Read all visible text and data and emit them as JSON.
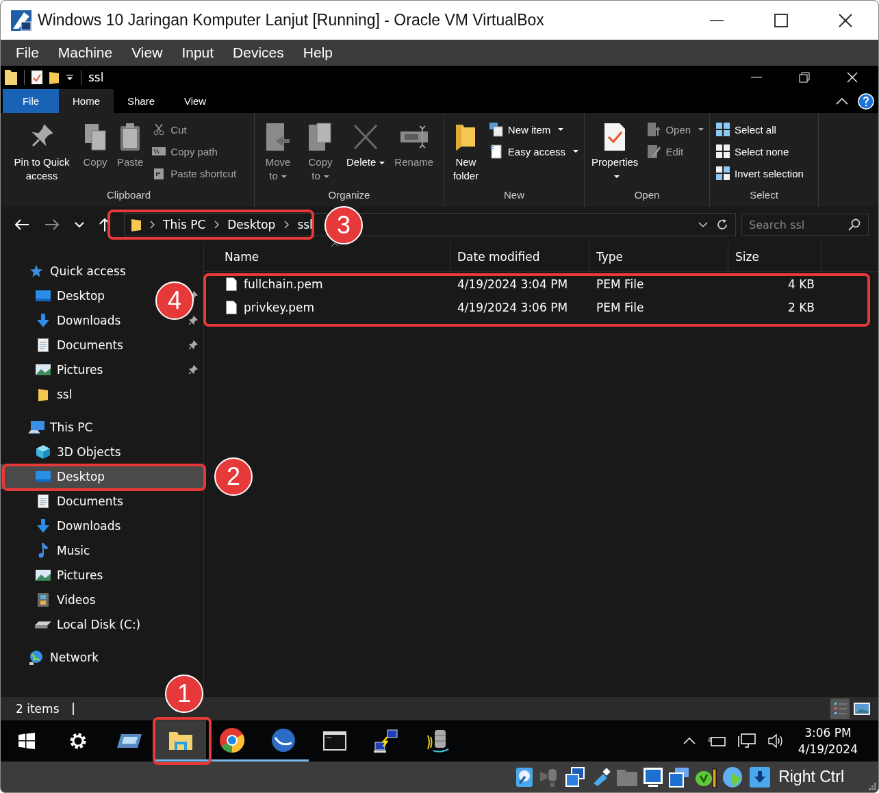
{
  "window": {
    "title": "Windows 10 Jaringan Komputer Lanjut [Running] - Oracle VM VirtualBox"
  },
  "menu": [
    "File",
    "Machine",
    "View",
    "Input",
    "Devices",
    "Help"
  ],
  "explorer": {
    "title": "ssl",
    "tabs": [
      {
        "label": "File",
        "kind": "file",
        "selected": false
      },
      {
        "label": "Home",
        "kind": "tab",
        "selected": true
      },
      {
        "label": "Share",
        "kind": "tab",
        "selected": false
      },
      {
        "label": "View",
        "kind": "tab",
        "selected": false
      }
    ],
    "ribbon": [
      {
        "label": "Clipboard",
        "items": [
          {
            "kind": "large",
            "label": "Pin to Quick access",
            "disabled": false,
            "dropdown": false
          },
          {
            "kind": "large",
            "label": "Copy",
            "disabled": true,
            "dropdown": false
          },
          {
            "kind": "large",
            "label": "Paste",
            "disabled": true,
            "dropdown": false
          },
          {
            "kind": "small",
            "label": "Cut",
            "disabled": true,
            "dropdown": false
          },
          {
            "kind": "small",
            "label": "Copy path",
            "disabled": true,
            "dropdown": false
          },
          {
            "kind": "small",
            "label": "Paste shortcut",
            "disabled": true,
            "dropdown": false
          }
        ]
      },
      {
        "label": "Organize",
        "items": [
          {
            "kind": "large",
            "label": "Move to",
            "disabled": true,
            "dropdown": true
          },
          {
            "kind": "large",
            "label": "Copy to",
            "disabled": true,
            "dropdown": true
          },
          {
            "kind": "large",
            "label": "Delete",
            "disabled": false,
            "dropdown": true
          },
          {
            "kind": "large",
            "label": "Rename",
            "disabled": true,
            "dropdown": false
          }
        ]
      },
      {
        "label": "New",
        "items": [
          {
            "kind": "large",
            "label": "New folder",
            "disabled": false,
            "dropdown": false
          },
          {
            "kind": "small",
            "label": "New item",
            "disabled": false,
            "dropdown": true
          },
          {
            "kind": "small",
            "label": "Easy access",
            "disabled": false,
            "dropdown": true
          }
        ]
      },
      {
        "label": "Open",
        "items": [
          {
            "kind": "large",
            "label": "Properties",
            "disabled": false,
            "dropdown": true
          },
          {
            "kind": "small",
            "label": "Open",
            "disabled": true,
            "dropdown": true
          },
          {
            "kind": "small",
            "label": "Edit",
            "disabled": true,
            "dropdown": false
          }
        ]
      },
      {
        "label": "Select",
        "items": [
          {
            "kind": "small",
            "label": "Select all",
            "disabled": false,
            "dropdown": false
          },
          {
            "kind": "small",
            "label": "Select none",
            "disabled": false,
            "dropdown": false
          },
          {
            "kind": "small",
            "label": "Invert selection",
            "disabled": false,
            "dropdown": false
          }
        ]
      }
    ],
    "breadcrumb": [
      "This PC",
      "Desktop",
      "ssl"
    ],
    "search": {
      "placeholder": "Search ssl"
    },
    "tree": [
      {
        "label": "Quick access",
        "children": [
          {
            "label": "Desktop",
            "pinned": true,
            "selected": false
          },
          {
            "label": "Downloads",
            "pinned": true,
            "selected": false
          },
          {
            "label": "Documents",
            "pinned": true,
            "selected": false
          },
          {
            "label": "Pictures",
            "pinned": true,
            "selected": false
          },
          {
            "label": "ssl",
            "pinned": false,
            "selected": false
          }
        ]
      },
      {
        "label": "This PC",
        "children": [
          {
            "label": "3D Objects",
            "pinned": false,
            "selected": false
          },
          {
            "label": "Desktop",
            "pinned": false,
            "selected": true
          },
          {
            "label": "Documents",
            "pinned": false,
            "selected": false
          },
          {
            "label": "Downloads",
            "pinned": false,
            "selected": false
          },
          {
            "label": "Music",
            "pinned": false,
            "selected": false
          },
          {
            "label": "Pictures",
            "pinned": false,
            "selected": false
          },
          {
            "label": "Videos",
            "pinned": false,
            "selected": false
          },
          {
            "label": "Local Disk (C:)",
            "pinned": false,
            "selected": false
          }
        ]
      },
      {
        "label": "Network"
      }
    ],
    "columns": [
      "Name",
      "Date modified",
      "Type",
      "Size"
    ],
    "rows": [
      [
        "fullchain.pem",
        "4/19/2024 3:04 PM",
        "PEM File",
        "4 KB"
      ],
      [
        "privkey.pem",
        "4/19/2024 3:06 PM",
        "PEM File",
        "2 KB"
      ]
    ],
    "status": "2 items"
  },
  "taskbar": {
    "apps": [
      {
        "selected": false,
        "running": false
      },
      {
        "selected": false,
        "running": false
      },
      {
        "selected": false,
        "running": false
      },
      {
        "selected": true,
        "running": true
      },
      {
        "selected": false,
        "running": true
      },
      {
        "selected": false,
        "running": true
      },
      {
        "selected": false,
        "running": false
      },
      {
        "selected": false,
        "running": false
      },
      {
        "selected": false,
        "running": false
      }
    ],
    "time": "3:06 PM",
    "date": "4/19/2024"
  },
  "vbox_status": {
    "host_key": "Right Ctrl"
  },
  "annotations": [
    "1",
    "2",
    "3",
    "4"
  ]
}
